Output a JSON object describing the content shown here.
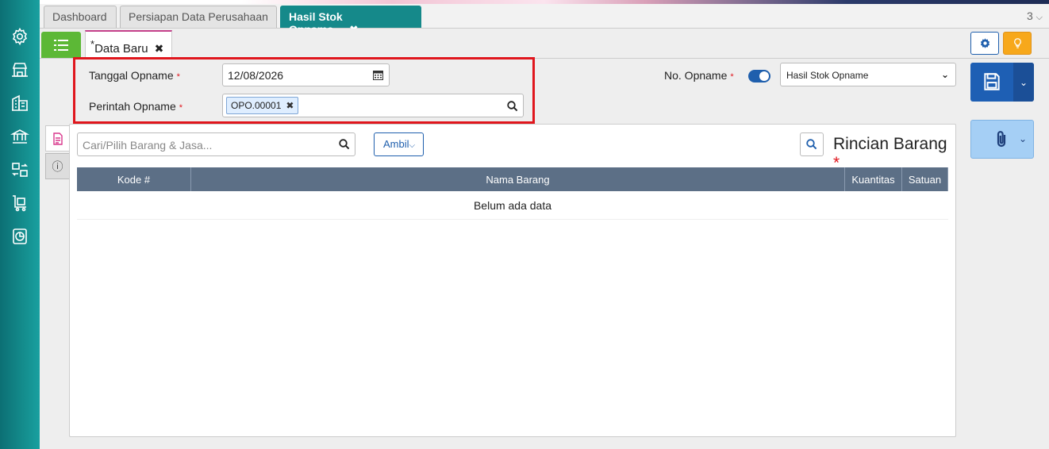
{
  "tabs": [
    {
      "label": "Dashboard"
    },
    {
      "label": "Persiapan Data Perusahaan"
    },
    {
      "label": "Hasil Stok Opname",
      "close": "✖"
    }
  ],
  "tab_count": "3",
  "subtab": {
    "marker": "*",
    "label": "Data Baru",
    "close": "✖"
  },
  "form": {
    "tanggal_label": "Tanggal Opname",
    "tanggal_value": "12/08/2026",
    "perintah_label": "Perintah Opname",
    "perintah_chip": "OPO.00001",
    "chip_close": "✖",
    "required_mark": "*",
    "no_opname_label": "No. Opname",
    "no_opname_toggle": true,
    "type_select": "Hasil Stok Opname"
  },
  "panel": {
    "search_placeholder": "Cari/Pilih Barang & Jasa...",
    "ambil_label": "Ambil",
    "title": "Rincian Barang",
    "columns": [
      "Kode #",
      "Nama Barang",
      "Kuantitas",
      "Satuan"
    ],
    "empty_text": "Belum ada data"
  },
  "colors": {
    "accent_teal": "#15898a",
    "primary_blue": "#1e5fb4",
    "highlight_red": "#e0161d",
    "menu_green": "#5cb836",
    "warning_orange": "#f7a81b"
  },
  "icons": {
    "sidebar": [
      "gear-icon",
      "store-icon",
      "building-icon",
      "bank-icon",
      "transfer-icon",
      "cart-icon",
      "report-icon"
    ]
  }
}
